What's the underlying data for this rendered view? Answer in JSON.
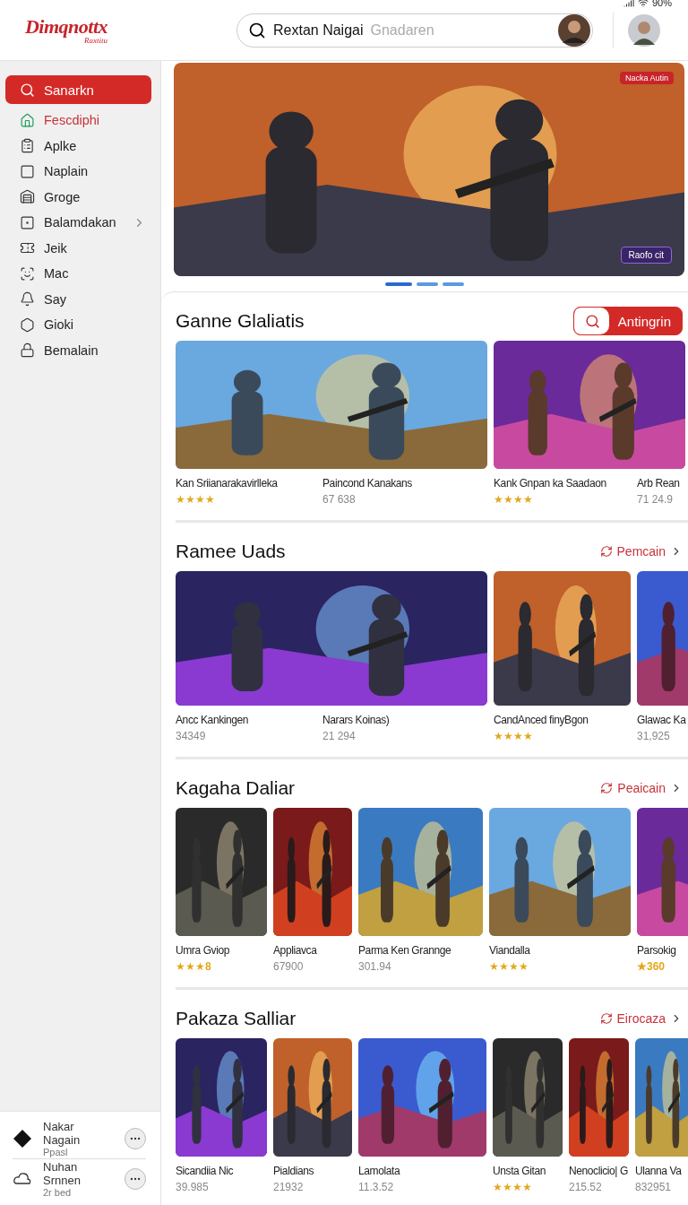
{
  "status_bar": {
    "battery": "90%"
  },
  "header": {
    "logo": "Dimqnottx",
    "logo_sub": "Raxtitu",
    "search": {
      "value": "Rextan Naigai",
      "hint": "Gnadaren"
    }
  },
  "sidebar": {
    "search_button": "Sanarkn",
    "items": [
      {
        "label": "Fescdiphi",
        "selected": true,
        "submenu": false
      },
      {
        "label": "Aplke",
        "selected": false,
        "submenu": false
      },
      {
        "label": "Naplain",
        "selected": false,
        "submenu": false
      },
      {
        "label": "Groge",
        "selected": false,
        "submenu": false
      },
      {
        "label": "Balamdakan",
        "selected": false,
        "submenu": true
      },
      {
        "label": "Jeik",
        "selected": false,
        "submenu": false
      },
      {
        "label": "Mac",
        "selected": false,
        "submenu": false
      },
      {
        "label": "Say",
        "selected": false,
        "submenu": false
      },
      {
        "label": "Gioki",
        "selected": false,
        "submenu": false
      },
      {
        "label": "Bemalain",
        "selected": false,
        "submenu": false
      }
    ],
    "accounts": [
      {
        "name": "Nakar Nagain",
        "detail": "Ppasl"
      },
      {
        "name": "Nuhan Srnnen",
        "detail": "2r bed"
      }
    ]
  },
  "hero": {
    "badge_top": "Nacka Autin",
    "badge_bottom": "Raofo cit",
    "slides": [
      {
        "selected": true
      },
      {
        "selected": false
      },
      {
        "selected": false
      }
    ]
  },
  "sections": [
    {
      "title": "Ganne Glaliatis",
      "action": {
        "kind": "button",
        "label": "Antingrin"
      },
      "cards": [
        {
          "captions": [
            {
              "title": "Kan Sriianarakavirlleka",
              "stars": 4
            },
            {
              "title": "Paincond Kanakans",
              "count": "67 638"
            }
          ]
        },
        {
          "captions": [
            {
              "title": "Kank Gnpan ka Saadaon",
              "stars": 4
            },
            {
              "title": "Arb Rean",
              "count": "71 24.9"
            }
          ]
        }
      ]
    },
    {
      "title": "Ramee Uads",
      "action": {
        "kind": "link",
        "label": "Pemcain"
      },
      "cards": [
        {
          "captions": [
            {
              "title": "Ancc Kankingen",
              "count": "34349"
            },
            {
              "title": "Narars Koinas)",
              "count": "21 294"
            }
          ]
        },
        {
          "captions": [
            {
              "title": "CandAnced finyBgon",
              "stars": 4
            }
          ]
        },
        {
          "captions": [
            {
              "title": "Glawac Ka",
              "count": "31,925"
            }
          ]
        }
      ]
    },
    {
      "title": "Kagaha Daliar",
      "action": {
        "kind": "link",
        "label": "Peaicain"
      },
      "cards": [
        {
          "captions": [
            {
              "title": "Umra Gviop",
              "stars": 3,
              "score": "8"
            }
          ]
        },
        {
          "captions": [
            {
              "title": "Appliavca",
              "count": "67900"
            }
          ]
        },
        {
          "captions": [
            {
              "title": "Parma Ken Grannge",
              "count": "301.94"
            }
          ]
        },
        {
          "captions": [
            {
              "title": "Viandalla",
              "stars": 4
            }
          ]
        },
        {
          "captions": [
            {
              "title": "Parsokig",
              "score": "★360"
            }
          ]
        }
      ]
    },
    {
      "title": "Pakaza Salliar",
      "action": {
        "kind": "link",
        "label": "Eirocaza"
      },
      "cards": [
        {
          "captions": [
            {
              "title": "Sicandiia Nic",
              "count": "39.985"
            }
          ]
        },
        {
          "captions": [
            {
              "title": "Pialdians",
              "count": "21932"
            }
          ]
        },
        {
          "captions": [
            {
              "title": "Lamolata",
              "count": "11.3.52"
            }
          ]
        },
        {
          "captions": [
            {
              "title": "Unsta Gitan",
              "stars": 4
            }
          ]
        },
        {
          "captions": [
            {
              "title": "Nenoclicio| G",
              "count": "215.52"
            }
          ]
        },
        {
          "captions": [
            {
              "title": "Ulanna Va",
              "count": "832951"
            }
          ]
        }
      ]
    }
  ]
}
